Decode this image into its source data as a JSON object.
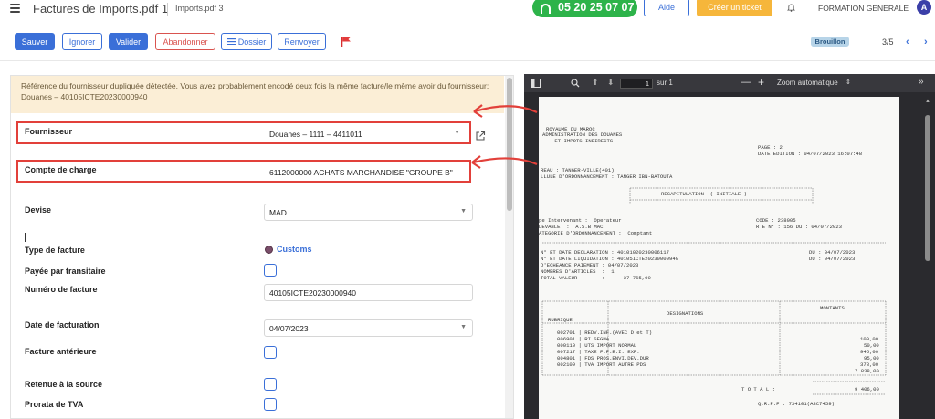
{
  "header": {
    "title": "Factures de Imports.pdf 1",
    "subtitle": "Imports.pdf 3",
    "phone": "05 20 25 07 07",
    "help_label": "Aide",
    "ticket_label": "Créer un ticket",
    "user_name": "FORMATION GENERALE",
    "avatar_letter": "A"
  },
  "toolbar": {
    "save_label": "Sauver",
    "ignore_label": "Ignorer",
    "validate_label": "Valider",
    "abandon_label": "Abandonner",
    "folder_label": "Dossier",
    "resend_label": "Renvoyer",
    "status_badge": "Brouillon",
    "pager": "3/5"
  },
  "warning": {
    "text": "Référence du fournisseur dupliquée détectée. Vous avez probablement encodé deux fois la même facture/le même avoir du fournisseur: Douanes – 40105ICTE20230000940"
  },
  "form": {
    "fournisseur_label": "Fournisseur",
    "fournisseur_value": "Douanes – 1111 – 4411011",
    "compte_label": "Compte de charge",
    "compte_value": "6112000000 ACHATS MARCHANDISE \"GROUPE B\"",
    "devise_label": "Devise",
    "devise_value": "MAD",
    "type_label": "Type de facture",
    "type_value": "Customs",
    "payee_label": "Payée par transitaire",
    "numero_label": "Numéro de facture",
    "numero_value": "40105ICTE20230000940",
    "date_label": "Date de facturation",
    "date_value": "04/07/2023",
    "anterieure_label": "Facture antérieure",
    "retenue_label": "Retenue à la source",
    "prorata_label": "Prorata de TVA"
  },
  "pdf": {
    "page_number": "1",
    "page_total": "sur 1",
    "zoom_label": "Zoom automatique",
    "lines": [
      "ROYAUME DU MAROC",
      "ADMINISTRATION DES DOUANES",
      "    ET IMPOTS INDIRECTS",
      "PAGE : 2",
      "DATE EDITION : 04/07/2023 16:07:48",
      "REAU : TANGER-VILLE(401)",
      "LLULE D'ORDONNANCEMENT : TANGER IBN-BATOUTA",
      "RECAPITULATION  ( INITIALE )",
      "pe Intervenant :  Operateur",
      "DEVABLE  :  A.S.B MAC",
      "ATEGORIE D'ORDONNANCEMENT :  Comptant",
      "CODE : 238005",
      "R E N* : 156 DU : 04/07/2023",
      "N° ET DATE DECLARATION : 40101020230006117",
      "N° ET DATE LIQUIDATION : 40105ICTE20230000940",
      "D'ECHEANCE PAIEMENT : 04/07/2023",
      "NOMBRES D'ARTICLES  :  1",
      "TOTAL VALEUR        :      37 765,00",
      "DU : 04/07/2023",
      "DU : 04/07/2023",
      "RUBRIQUE",
      "DESIGNATIONS",
      "MONTANTS",
      "002701 | REDV.INF.(AVEC D et T)",
      "006901 | RI SEGMA",
      "000110 | UTS IMPORT NORMAL",
      "007217 | TAXE F.P.E.I. EXP.",
      "004801 | FDS PROS.ENVI.DEV.DUR",
      "002109 | TVA IMPORT AUTRE PDS",
      "100,00",
      "50,00",
      "945,00",
      "95,00",
      "378,00",
      "7 838,00",
      "T O T A L :",
      "9 406,00",
      "Q.R.F.F : 734101(A3C7459)"
    ]
  }
}
